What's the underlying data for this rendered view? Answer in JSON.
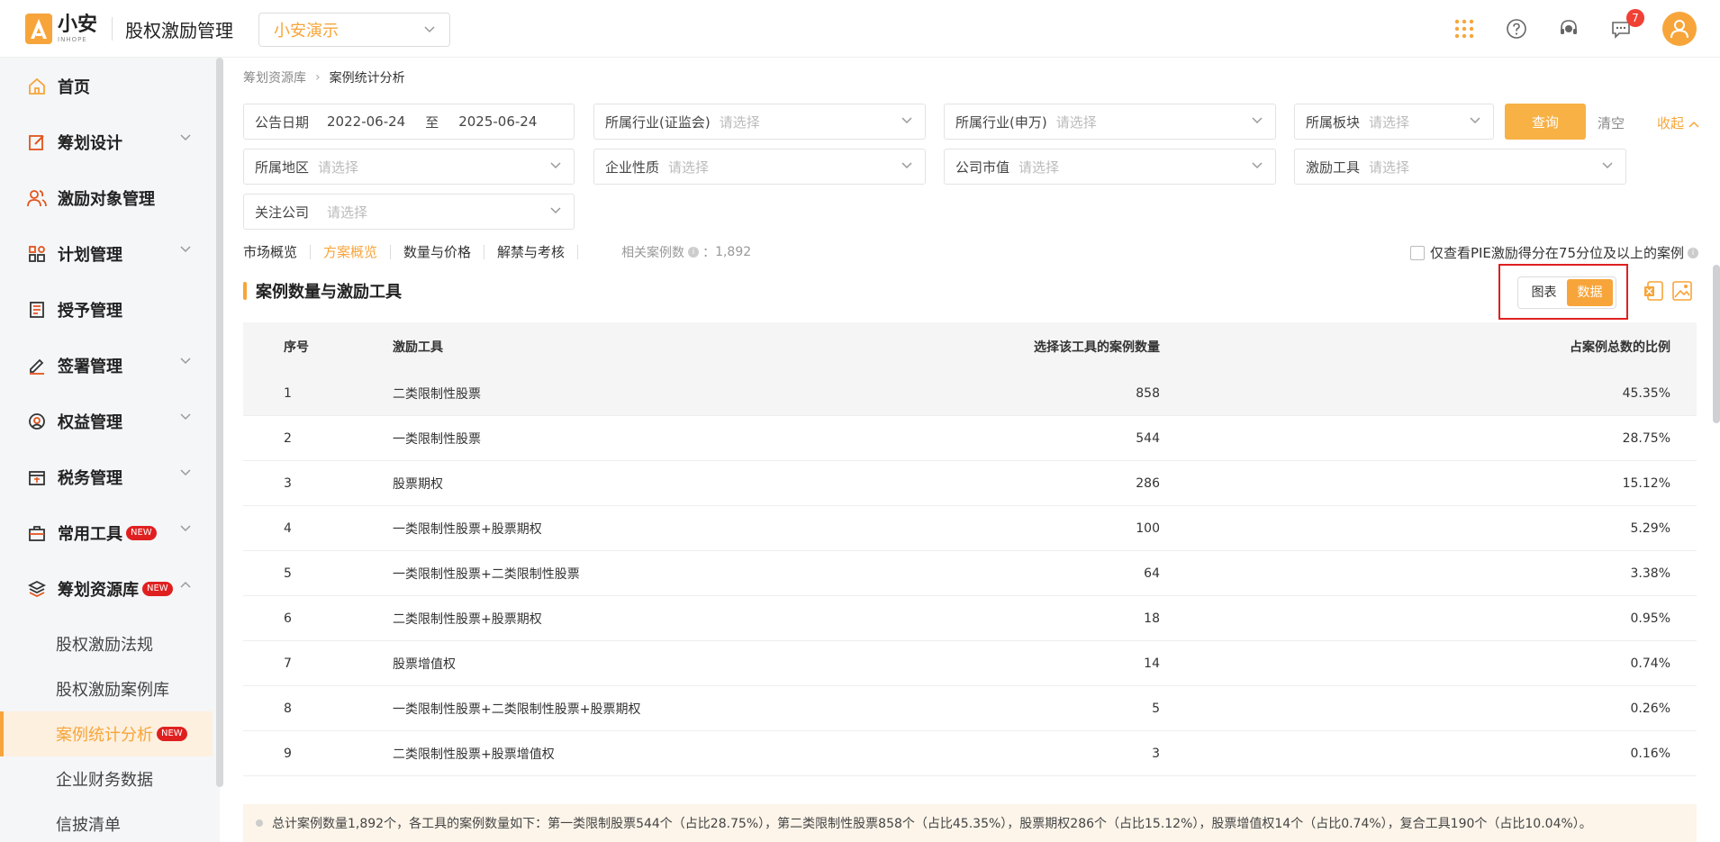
{
  "header": {
    "logo_cn": "小安",
    "logo_en": "INHOPE",
    "app_title": "股权激励管理",
    "org_select": "小安演示",
    "notification_count": "7"
  },
  "sidebar": {
    "items": [
      {
        "label": "首页"
      },
      {
        "label": "筹划设计"
      },
      {
        "label": "激励对象管理"
      },
      {
        "label": "计划管理"
      },
      {
        "label": "授予管理"
      },
      {
        "label": "签署管理"
      },
      {
        "label": "权益管理"
      },
      {
        "label": "税务管理"
      },
      {
        "label": "常用工具",
        "tag": "NEW"
      },
      {
        "label": "筹划资源库",
        "tag": "NEW"
      }
    ],
    "sub_items": [
      {
        "label": "股权激励法规"
      },
      {
        "label": "股权激励案例库"
      },
      {
        "label": "案例统计分析",
        "tag": "NEW"
      },
      {
        "label": "企业财务数据"
      },
      {
        "label": "信披清单"
      }
    ]
  },
  "breadcrumb": {
    "parent": "筹划资源库",
    "current": "案例统计分析"
  },
  "filters": {
    "date_label": "公告日期",
    "date_start": "2022-06-24",
    "date_to": "至",
    "date_end": "2025-06-24",
    "industry_csrc": {
      "label": "所属行业(证监会)",
      "placeholder": "请选择"
    },
    "industry_sw": {
      "label": "所属行业(申万)",
      "placeholder": "请选择"
    },
    "board": {
      "label": "所属板块",
      "placeholder": "请选择"
    },
    "region": {
      "label": "所属地区",
      "placeholder": "请选择"
    },
    "nature": {
      "label": "企业性质",
      "placeholder": "请选择"
    },
    "market_cap": {
      "label": "公司市值",
      "placeholder": "请选择"
    },
    "tool": {
      "label": "激励工具",
      "placeholder": "请选择"
    },
    "watch": {
      "label": "关注公司",
      "placeholder": "请选择"
    },
    "query_btn": "查询",
    "clear": "清空",
    "collapse": "收起"
  },
  "tabs": [
    "市场概览",
    "方案概览",
    "数量与价格",
    "解禁与考核"
  ],
  "case_count": {
    "label": "相关案例数",
    "value": "1,892"
  },
  "pie_filter": "仅查看PIE激励得分在75分位及以上的案例",
  "section_title": "案例数量与激励工具",
  "view_toggle": {
    "chart": "图表",
    "data": "数据"
  },
  "table": {
    "headers": [
      "序号",
      "激励工具",
      "选择该工具的案例数量",
      "占案例总数的比例"
    ],
    "rows": [
      [
        "1",
        "二类限制性股票",
        "858",
        "45.35%"
      ],
      [
        "2",
        "一类限制性股票",
        "544",
        "28.75%"
      ],
      [
        "3",
        "股票期权",
        "286",
        "15.12%"
      ],
      [
        "4",
        "一类限制性股票+股票期权",
        "100",
        "5.29%"
      ],
      [
        "5",
        "一类限制性股票+二类限制性股票",
        "64",
        "3.38%"
      ],
      [
        "6",
        "二类限制性股票+股票期权",
        "18",
        "0.95%"
      ],
      [
        "7",
        "股票增值权",
        "14",
        "0.74%"
      ],
      [
        "8",
        "一类限制性股票+二类限制性股票+股票期权",
        "5",
        "0.26%"
      ],
      [
        "9",
        "二类限制性股票+股票增值权",
        "3",
        "0.16%"
      ]
    ]
  },
  "note": "总计案例数量1,892个，各工具的案例数量如下：第一类限制股票544个（占比28.75%），第二类限制性股票858个（占比45.35%），股票期权286个（占比15.12%），股票增值权14个（占比0.74%），复合工具190个（占比10.04%）。",
  "colors": {
    "accent": "#f7a53a",
    "new_tag": "#e02020",
    "highlight_box": "#e02020"
  }
}
